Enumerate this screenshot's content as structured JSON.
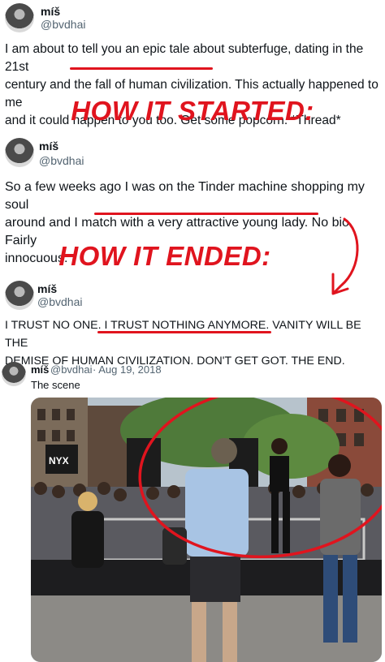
{
  "tweet1": {
    "name": "míš",
    "handle": "@bvdhai",
    "lines": [
      "I am about to tell you an epic tale about subterfuge, dating in the 21st",
      "century and the fall of human civilization. This actually happened to me",
      "and it could happen to you too. Get some popcorn. *Thread*"
    ]
  },
  "banner_started": "HOW IT STARTED:",
  "tweet2": {
    "name": "míš",
    "handle": "@bvdhai",
    "lines": [
      "So a few weeks ago I was on the Tinder machine shopping my soul",
      "around and I match with a very attractive young lady. No bio. Fairly",
      "innocuous."
    ]
  },
  "banner_ended": "HOW IT ENDED:",
  "tweet3": {
    "name": "míš",
    "handle": "@bvdhai",
    "lines": [
      "I TRUST NO ONE. I TRUST NOTHING ANYMORE. VANITY WILL BE THE",
      "DEMISE OF HUMAN CIVILIZATION. DON'T GET GOT. THE END."
    ]
  },
  "tweet4": {
    "name": "míš",
    "handle": "@bvdhai",
    "date": "· Aug 19, 2018",
    "text": "The scene"
  },
  "photo": {
    "store_sign": "NYX"
  },
  "colors": {
    "annotation_red": "#e0141e",
    "handle_gray": "#536471"
  }
}
